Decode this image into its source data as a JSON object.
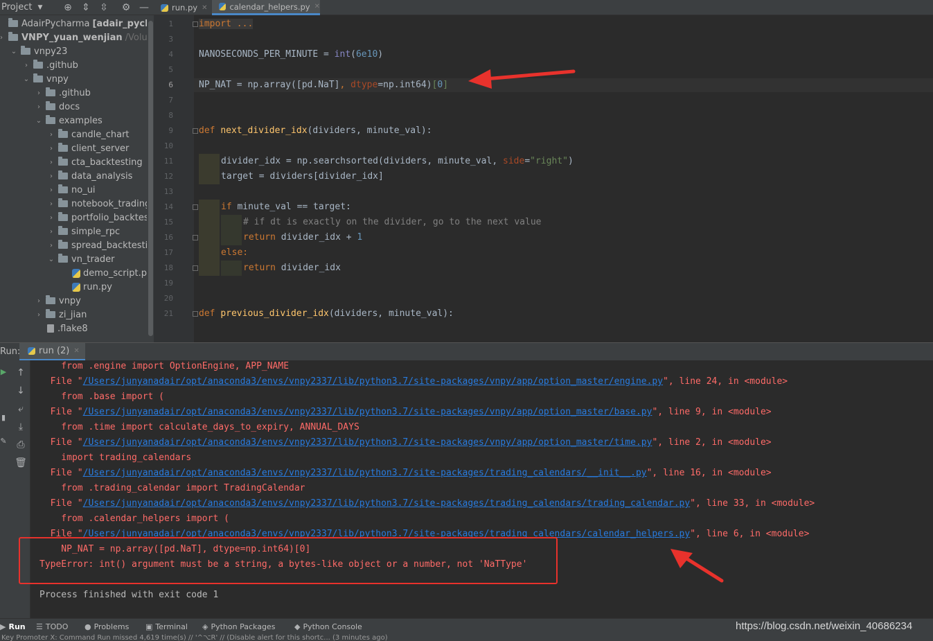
{
  "project": {
    "title": "Project",
    "tree": [
      {
        "label": "AdairPycharma",
        "suffix": "[adair_pycha",
        "depth": 0,
        "kind": "folder",
        "expanded": null
      },
      {
        "label": "VNPY_yuan_wenjian",
        "suffix": "/Volun",
        "depth": 0,
        "kind": "folder",
        "expanded": false,
        "bold": true
      },
      {
        "label": "vnpy23",
        "depth": 1,
        "kind": "folder",
        "expanded": true
      },
      {
        "label": ".github",
        "depth": 2,
        "kind": "folder",
        "expanded": false
      },
      {
        "label": "vnpy",
        "depth": 2,
        "kind": "folder",
        "expanded": true
      },
      {
        "label": ".github",
        "depth": 3,
        "kind": "folder",
        "expanded": false
      },
      {
        "label": "docs",
        "depth": 3,
        "kind": "folder",
        "expanded": false
      },
      {
        "label": "examples",
        "depth": 3,
        "kind": "folder",
        "expanded": true
      },
      {
        "label": "candle_chart",
        "depth": 4,
        "kind": "folder",
        "expanded": false
      },
      {
        "label": "client_server",
        "depth": 4,
        "kind": "folder",
        "expanded": false
      },
      {
        "label": "cta_backtesting",
        "depth": 4,
        "kind": "folder",
        "expanded": false
      },
      {
        "label": "data_analysis",
        "depth": 4,
        "kind": "folder",
        "expanded": false
      },
      {
        "label": "no_ui",
        "depth": 4,
        "kind": "folder",
        "expanded": false
      },
      {
        "label": "notebook_trading",
        "depth": 4,
        "kind": "folder",
        "expanded": false
      },
      {
        "label": "portfolio_backtes",
        "depth": 4,
        "kind": "folder",
        "expanded": false
      },
      {
        "label": "simple_rpc",
        "depth": 4,
        "kind": "folder",
        "expanded": false
      },
      {
        "label": "spread_backtesti",
        "depth": 4,
        "kind": "folder",
        "expanded": false
      },
      {
        "label": "vn_trader",
        "depth": 4,
        "kind": "folder",
        "expanded": true
      },
      {
        "label": "demo_script.p",
        "depth": 5,
        "kind": "py",
        "expanded": null
      },
      {
        "label": "run.py",
        "depth": 5,
        "kind": "py",
        "expanded": null
      },
      {
        "label": "vnpy",
        "depth": 3,
        "kind": "folder",
        "expanded": false
      },
      {
        "label": "zi_jian",
        "depth": 3,
        "kind": "folder",
        "expanded": false
      },
      {
        "label": ".flake8",
        "depth": 3,
        "kind": "file",
        "expanded": null
      }
    ]
  },
  "editor": {
    "tabs": [
      {
        "label": "run.py",
        "active": false
      },
      {
        "label": "calendar_helpers.py",
        "active": true
      }
    ],
    "line_numbers": [
      "1",
      "3",
      "4",
      "5",
      "6",
      "7",
      "8",
      "9",
      "10",
      "11",
      "12",
      "13",
      "14",
      "15",
      "16",
      "17",
      "18",
      "19",
      "20",
      "21"
    ],
    "current_line": "6",
    "code": {
      "l1": "import ...",
      "l4_a": "NANOSECONDS_PER_MINUTE = ",
      "l4_b": "int",
      "l4_c": "(",
      "l4_d": "6e10",
      "l4_e": ")",
      "l6_a": "NP_NAT = np.array(",
      "l6_b": "[pd.NaT]",
      "l6_c": ", ",
      "l6_d": "dtype",
      "l6_e": "=np.int64)",
      "l6_f": "[",
      "l6_g": "0",
      "l6_h": "]",
      "l9_def": "def ",
      "l9_fn": "next_divider_idx",
      "l9_args": "(dividers, minute_val):",
      "l11_a": "divider_idx = np.searchsorted(dividers, minute_val, ",
      "l11_b": "side",
      "l11_c": "=",
      "l11_d": "\"right\"",
      "l11_e": ")",
      "l12": "target = dividers[divider_idx]",
      "l14_kw": "if ",
      "l14_rest": "minute_val == target:",
      "l15": "# if dt is exactly on the divider, go to the next value",
      "l16_kw": "return ",
      "l16_rest": "divider_idx + ",
      "l16_num": "1",
      "l17": "else:",
      "l18_kw": "return ",
      "l18_rest": "divider_idx",
      "l21_def": "def ",
      "l21_fn": "previous_divider_idx",
      "l21_args": "(dividers, minute_val):"
    }
  },
  "run": {
    "label": "Run:",
    "tab_label": "run (2)",
    "console": [
      {
        "pre": "    from .engine import OptionEngine, APP_NAME",
        "link": "",
        "post": ""
      },
      {
        "pre": "  File \"",
        "link": "/Users/junyanadair/opt/anaconda3/envs/vnpy2337/lib/python3.7/site-packages/vnpy/app/option_master/engine.py",
        "post": "\", line 24, in <module>"
      },
      {
        "pre": "    from .base import (",
        "link": "",
        "post": ""
      },
      {
        "pre": "  File \"",
        "link": "/Users/junyanadair/opt/anaconda3/envs/vnpy2337/lib/python3.7/site-packages/vnpy/app/option_master/base.py",
        "post": "\", line 9, in <module>"
      },
      {
        "pre": "    from .time import calculate_days_to_expiry, ANNUAL_DAYS",
        "link": "",
        "post": ""
      },
      {
        "pre": "  File \"",
        "link": "/Users/junyanadair/opt/anaconda3/envs/vnpy2337/lib/python3.7/site-packages/vnpy/app/option_master/time.py",
        "post": "\", line 2, in <module>"
      },
      {
        "pre": "    import trading_calendars",
        "link": "",
        "post": ""
      },
      {
        "pre": "  File \"",
        "link": "/Users/junyanadair/opt/anaconda3/envs/vnpy2337/lib/python3.7/site-packages/trading_calendars/__init__.py",
        "post": "\", line 16, in <module>"
      },
      {
        "pre": "    from .trading_calendar import TradingCalendar",
        "link": "",
        "post": ""
      },
      {
        "pre": "  File \"",
        "link": "/Users/junyanadair/opt/anaconda3/envs/vnpy2337/lib/python3.7/site-packages/trading_calendars/trading_calendar.py",
        "post": "\", line 33, in <module>"
      },
      {
        "pre": "    from .calendar_helpers import (",
        "link": "",
        "post": ""
      },
      {
        "pre": "  File \"",
        "link": "/Users/junyanadair/opt/anaconda3/envs/vnpy2337/lib/python3.7/site-packages/trading_calendars/calendar_helpers.py",
        "post": "\", line 6, in <module>"
      },
      {
        "pre": "    NP_NAT = np.array([pd.NaT], dtype=np.int64)[0]",
        "link": "",
        "post": ""
      },
      {
        "pre": "TypeError: int() argument must be a string, a bytes-like object or a number, not 'NaTType'",
        "link": "",
        "post": ""
      }
    ],
    "exit_message": "Process finished with exit code 1"
  },
  "bottom_tabs": [
    {
      "label": "Run",
      "icon": "run-icon",
      "active": true
    },
    {
      "label": "TODO",
      "icon": "todo-icon",
      "active": false
    },
    {
      "label": "Problems",
      "icon": "problems-icon",
      "active": false
    },
    {
      "label": "Terminal",
      "icon": "terminal-icon",
      "active": false
    },
    {
      "label": "Python Packages",
      "icon": "packages-icon",
      "active": false
    },
    {
      "label": "Python Console",
      "icon": "python-console-icon",
      "active": false
    }
  ],
  "watermark": "https://blog.csdn.net/weixin_40686234",
  "status_text": "Key Promoter X: Command Run missed 4,619 time(s) // '^⌥R' // (Disable alert for this shortc... (3 minutes ago)",
  "colors": {
    "error_text": "#ff6b68",
    "link": "#287bde",
    "annotation_red": "#e8322c",
    "accent": "#4a88c7"
  }
}
